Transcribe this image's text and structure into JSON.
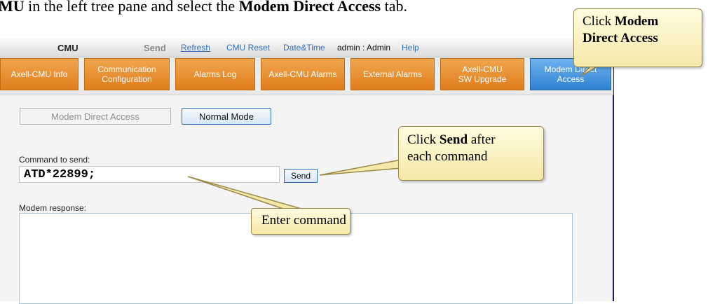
{
  "doc_text": {
    "prefix": "MU",
    "middle": " in the left tree pane and select the ",
    "bold_tab": "Modem Direct Access",
    "suffix": " tab."
  },
  "menubar": {
    "cmu": "CMU",
    "send": "Send",
    "refresh": "Refresh",
    "cmu_reset": "CMU Reset",
    "date_time": "Date&Time",
    "user": "admin : Admin",
    "help": "Help"
  },
  "tabs": [
    {
      "line1": "Axell-CMU Info",
      "line2": ""
    },
    {
      "line1": "Communication",
      "line2": "Configuration"
    },
    {
      "line1": "Alarms Log",
      "line2": ""
    },
    {
      "line1": "Axell-CMU Alarms",
      "line2": ""
    },
    {
      "line1": "External Alarms",
      "line2": ""
    },
    {
      "line1": "Axell-CMU",
      "line2": "SW Upgrade"
    },
    {
      "line1": "Modem Direct",
      "line2": "Access"
    }
  ],
  "buttons": {
    "modem_direct_access": "Modem Direct Access",
    "normal_mode": "Normal Mode",
    "send": "Send"
  },
  "form": {
    "command_label": "Command to send:",
    "command_value": "ATD*22899;",
    "response_label": "Modem response:"
  },
  "callouts": {
    "top_prefix": "Click ",
    "top_bold_1": "Modem",
    "top_bold_2": "Direct Access",
    "send_prefix": "Click ",
    "send_bold": "Send",
    "send_suffix": " after",
    "send_line2": "each command",
    "enter": "Enter command"
  },
  "colors": {
    "tab_orange": "#e88f2e",
    "tab_active_blue": "#4a9ae0",
    "callout_fill": "#fbf2c2",
    "link_blue": "#2f6fb5"
  }
}
